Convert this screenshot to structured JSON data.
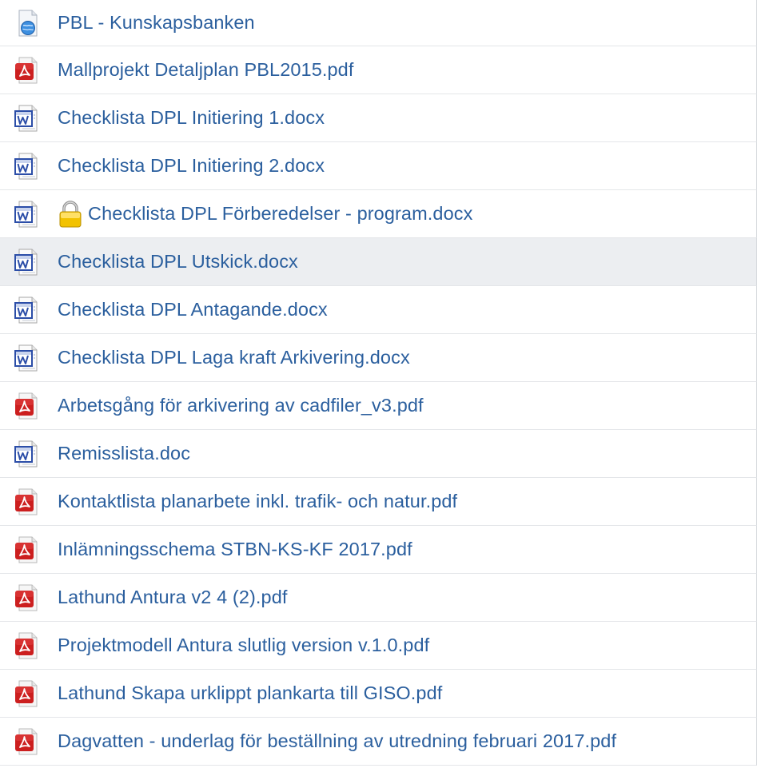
{
  "files": [
    {
      "name": "PBL - Kunskapsbanken",
      "type": "web",
      "icon": "web-link-icon",
      "locked": false,
      "selected": false
    },
    {
      "name": "Mallprojekt Detaljplan PBL2015.pdf",
      "type": "pdf",
      "icon": "pdf-file-icon",
      "locked": false,
      "selected": false
    },
    {
      "name": "Checklista DPL Initiering 1.docx",
      "type": "word",
      "icon": "word-file-icon",
      "locked": false,
      "selected": false
    },
    {
      "name": "Checklista DPL Initiering 2.docx",
      "type": "word",
      "icon": "word-file-icon",
      "locked": false,
      "selected": false
    },
    {
      "name": "Checklista DPL Förberedelser - program.docx",
      "type": "word",
      "icon": "word-file-icon",
      "locked": true,
      "selected": false
    },
    {
      "name": "Checklista DPL Utskick.docx",
      "type": "word",
      "icon": "word-file-icon",
      "locked": false,
      "selected": true
    },
    {
      "name": "Checklista DPL Antagande.docx",
      "type": "word",
      "icon": "word-file-icon",
      "locked": false,
      "selected": false
    },
    {
      "name": "Checklista DPL Laga kraft Arkivering.docx",
      "type": "word",
      "icon": "word-file-icon",
      "locked": false,
      "selected": false
    },
    {
      "name": "Arbetsgång för arkivering av cadfiler_v3.pdf",
      "type": "pdf",
      "icon": "pdf-file-icon",
      "locked": false,
      "selected": false
    },
    {
      "name": "Remisslista.doc",
      "type": "word",
      "icon": "word-file-icon",
      "locked": false,
      "selected": false
    },
    {
      "name": "Kontaktlista planarbete inkl. trafik- och natur.pdf",
      "type": "pdf",
      "icon": "pdf-file-icon",
      "locked": false,
      "selected": false
    },
    {
      "name": "Inlämningsschema STBN-KS-KF 2017.pdf",
      "type": "pdf",
      "icon": "pdf-file-icon",
      "locked": false,
      "selected": false
    },
    {
      "name": "Lathund Antura v2 4 (2).pdf",
      "type": "pdf",
      "icon": "pdf-file-icon",
      "locked": false,
      "selected": false
    },
    {
      "name": "Projektmodell Antura slutlig version v.1.0.pdf",
      "type": "pdf",
      "icon": "pdf-file-icon",
      "locked": false,
      "selected": false
    },
    {
      "name": "Lathund Skapa urklippt plankarta till GISO.pdf",
      "type": "pdf",
      "icon": "pdf-file-icon",
      "locked": false,
      "selected": false
    },
    {
      "name": "Dagvatten - underlag för beställning av utredning februari 2017.pdf",
      "type": "pdf",
      "icon": "pdf-file-icon",
      "locked": false,
      "selected": false
    }
  ],
  "colors": {
    "link": "#2b5f9e",
    "selected_row": "#eceef1",
    "pdf_red": "#cc1f1f",
    "word_blue": "#2c4ea8"
  }
}
